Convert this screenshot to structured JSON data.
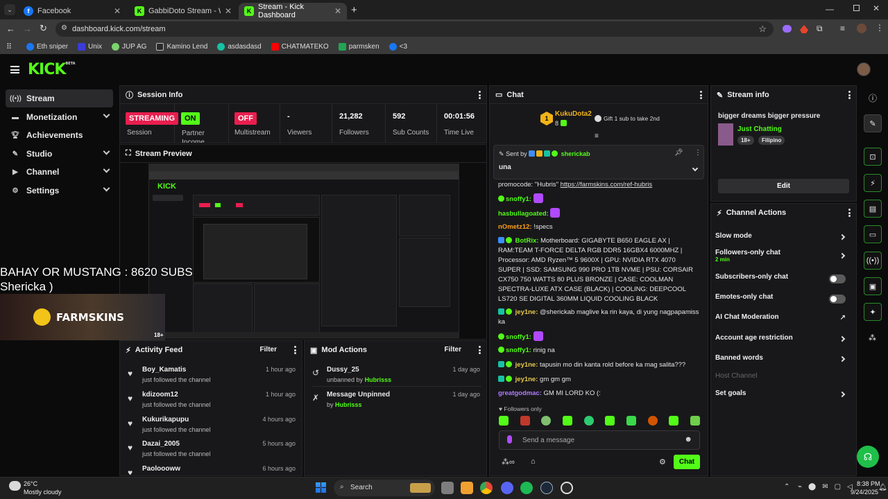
{
  "browser": {
    "tabs": [
      {
        "title": "Facebook",
        "icon": "facebook-icon"
      },
      {
        "title": "GabbiDoto Stream - Watch Live",
        "icon": "kick-icon"
      },
      {
        "title": "Stream - Kick Dashboard",
        "icon": "kick-icon"
      }
    ],
    "url": "dashboard.kick.com/stream",
    "bookmarks": [
      "Eth sniper",
      "Unix",
      "JUP AG",
      "Kamino Lend",
      "asdasdasd",
      "CHATMATEKO",
      "parmsken",
      "<3"
    ]
  },
  "kick": {
    "logo": "KICK",
    "logo_beta": "BETA"
  },
  "sidebar": {
    "items": [
      {
        "label": "Stream",
        "icon": "stream-icon"
      },
      {
        "label": "Monetization",
        "icon": "monetization-icon"
      },
      {
        "label": "Achievements",
        "icon": "trophy-icon"
      },
      {
        "label": "Studio",
        "icon": "studio-icon"
      },
      {
        "label": "Channel",
        "icon": "channel-icon"
      },
      {
        "label": "Settings",
        "icon": "gear-icon"
      }
    ]
  },
  "session": {
    "title": "Session Info",
    "stats": [
      {
        "value": "STREAMING",
        "label": "Session"
      },
      {
        "value": "ON",
        "label": "Partner Income"
      },
      {
        "value": "OFF",
        "label": "Multistream"
      },
      {
        "value": "-",
        "label": "Viewers"
      },
      {
        "value": "21,282",
        "label": "Followers"
      },
      {
        "value": "592",
        "label": "Sub Counts"
      },
      {
        "value": "00:01:56",
        "label": "Time Live"
      }
    ]
  },
  "preview": {
    "title": "Stream Preview",
    "overlay_line1": "BAHAY OR MUSTANG : 8620 SUBS",
    "overlay_line2": "Shericka )",
    "sponsor": "FARMSKINS",
    "rating": "18+"
  },
  "activity": {
    "title": "Activity Feed",
    "filter": "Filter",
    "items": [
      {
        "name": "Boy_Kamatis",
        "action": "just followed the channel",
        "time": "1 hour ago"
      },
      {
        "name": "kdizoom12",
        "action": "just followed the channel",
        "time": "1 hour ago"
      },
      {
        "name": "Kukurikapupu",
        "action": "just followed the channel",
        "time": "4 hours ago"
      },
      {
        "name": "Dazai_2005",
        "action": "just followed the channel",
        "time": "5 hours ago"
      },
      {
        "name": "Paoloooww",
        "action": "",
        "time": "6 hours ago"
      }
    ]
  },
  "mod": {
    "title": "Mod Actions",
    "filter": "Filter",
    "items": [
      {
        "name": "Dussy_25",
        "action": "unbanned by",
        "by": "Hubrisss",
        "time": "1 day ago"
      },
      {
        "name": "Message Unpinned",
        "action": "by",
        "by": "Hubrisss",
        "time": "1 day ago"
      }
    ]
  },
  "chat": {
    "title": "Chat",
    "top_gifter": "KukuDota2",
    "top_gifter_count": "8",
    "top_rank": "1",
    "gift_prompt": "Gift 1 sub to take 2nd",
    "pinned_by_label": "Sent by",
    "pinned_user": "sherickab",
    "pinned_text": "una",
    "messages": [
      {
        "user": "",
        "text": "promocode: \"Hubris\" ",
        "link": "https://farmskins.com/ref-hubris"
      },
      {
        "user": "snoffy1:",
        "text": ""
      },
      {
        "user": "hasbullagoated:",
        "text": ""
      },
      {
        "user": "nOmetz12:",
        "text": "!specs"
      },
      {
        "user": "BotRix:",
        "text": "Motherboard: GIGABYTE B650 EAGLE AX | RAM:TEAM T-FORCE DELTA RGB DDR5 16GBX4 6000MHZ | Processor: AMD Ryzen™ 5 9600X | GPU: NVIDIA RTX 4070 SUPER | SSD: SAMSUNG 990 PRO 1TB NVME | PSU: CORSAIR CX750 750 WATTS 80 PLUS BRONZE | CASE: COOLMAN SPECTRA-LUXE ATX CASE (BLACK) | COOLING: DEEPCOOL LS720 SE DIGITAL 360MM LIQUID COOLING BLACK"
      },
      {
        "user": "jey1ne:",
        "text": "@sherickab maglive ka rin kaya, di yung nagpapamiss ka"
      },
      {
        "user": "snoffy1:",
        "text": ""
      },
      {
        "user": "snoffy1:",
        "text": "rinig na"
      },
      {
        "user": "jey1ne:",
        "text": "tapusin mo din kanta rold before ka mag salita???"
      },
      {
        "user": "jey1ne:",
        "text": "gm gm gm"
      },
      {
        "user": "greatgodmac:",
        "text": "GM MI LORD KO (:"
      }
    ],
    "followers_only": "Followers only",
    "placeholder": "Send a message",
    "send": "Chat"
  },
  "stream_info": {
    "title": "Stream info",
    "stream_title": "bigger dreams bigger pressure",
    "category": "Just Chatting",
    "tags": [
      "18+",
      "Filipino"
    ],
    "edit": "Edit"
  },
  "channel_actions": {
    "title": "Channel Actions",
    "items": [
      {
        "label": "Slow mode",
        "sub": "",
        "control": "chevron"
      },
      {
        "label": "Followers-only chat",
        "sub": "2 min",
        "control": "chevron"
      },
      {
        "label": "Subscribers-only chat",
        "sub": "",
        "control": "toggle-off"
      },
      {
        "label": "Emotes-only chat",
        "sub": "",
        "control": "toggle-off"
      },
      {
        "label": "AI Chat Moderation",
        "sub": "",
        "control": "external"
      },
      {
        "label": "Account age restriction",
        "sub": "",
        "control": "chevron"
      },
      {
        "label": "Banned words",
        "sub": "",
        "control": "chevron"
      },
      {
        "label": "Host Channel",
        "sub": "",
        "control": "none"
      },
      {
        "label": "Set goals",
        "sub": "",
        "control": "chevron"
      }
    ]
  },
  "taskbar": {
    "weather_temp": "26°C",
    "weather_desc": "Mostly cloudy",
    "search": "Search",
    "time": "8:38 PM",
    "date": "9/24/2025"
  },
  "colors": {
    "accent": "#53fc18",
    "streaming": "#e91e4f",
    "off": "#e91e4f",
    "panel": "#18181a"
  }
}
